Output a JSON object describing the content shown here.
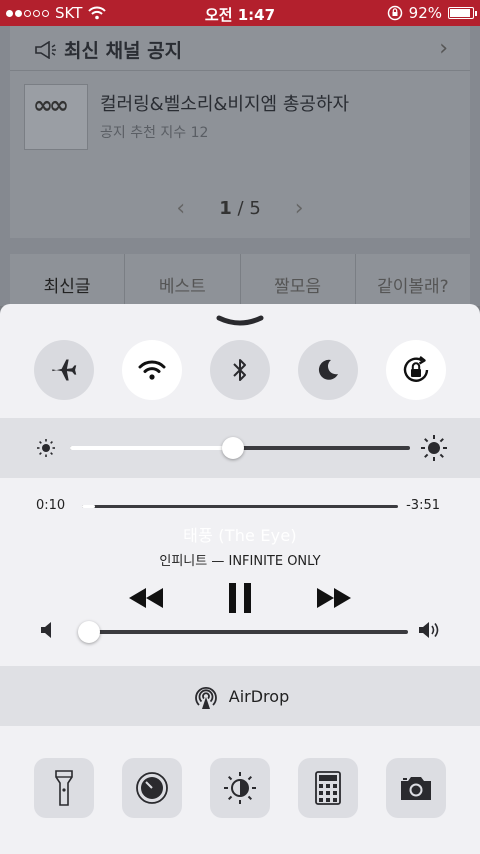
{
  "status_bar": {
    "carrier": "SKT",
    "time": "오전 1:47",
    "battery": "92%",
    "battery_level": 0.92,
    "signal_bars_filled": 2,
    "signal_bars_total": 5
  },
  "background_app": {
    "notice": {
      "title": "최신 채널 공지",
      "item_title": "컬러링&벨소리&비지엠 총공하자",
      "item_sub": "공지 추천 지수 12"
    },
    "pager": {
      "current": "1",
      "separator": "/",
      "total": "5"
    },
    "tabs": [
      "최신글",
      "베스트",
      "짤모음",
      "같이볼래?"
    ]
  },
  "control_center": {
    "toggles": [
      {
        "name": "airplane-icon",
        "on": false
      },
      {
        "name": "wifi-icon",
        "on": true
      },
      {
        "name": "bluetooth-icon",
        "on": false
      },
      {
        "name": "do-not-disturb-icon",
        "on": false
      },
      {
        "name": "rotation-lock-icon",
        "on": true
      }
    ],
    "brightness": 0.48,
    "music": {
      "elapsed": "0:10",
      "remaining": "-3:51",
      "progress": 0.04,
      "song": "태풍 (The Eye)",
      "artist": "인피니트 — INFINITE ONLY",
      "volume": 0.02
    },
    "airdrop_label": "AirDrop",
    "shortcuts": [
      "flashlight-icon",
      "timer-icon",
      "night-shift-icon",
      "calculator-icon",
      "camera-icon"
    ]
  }
}
